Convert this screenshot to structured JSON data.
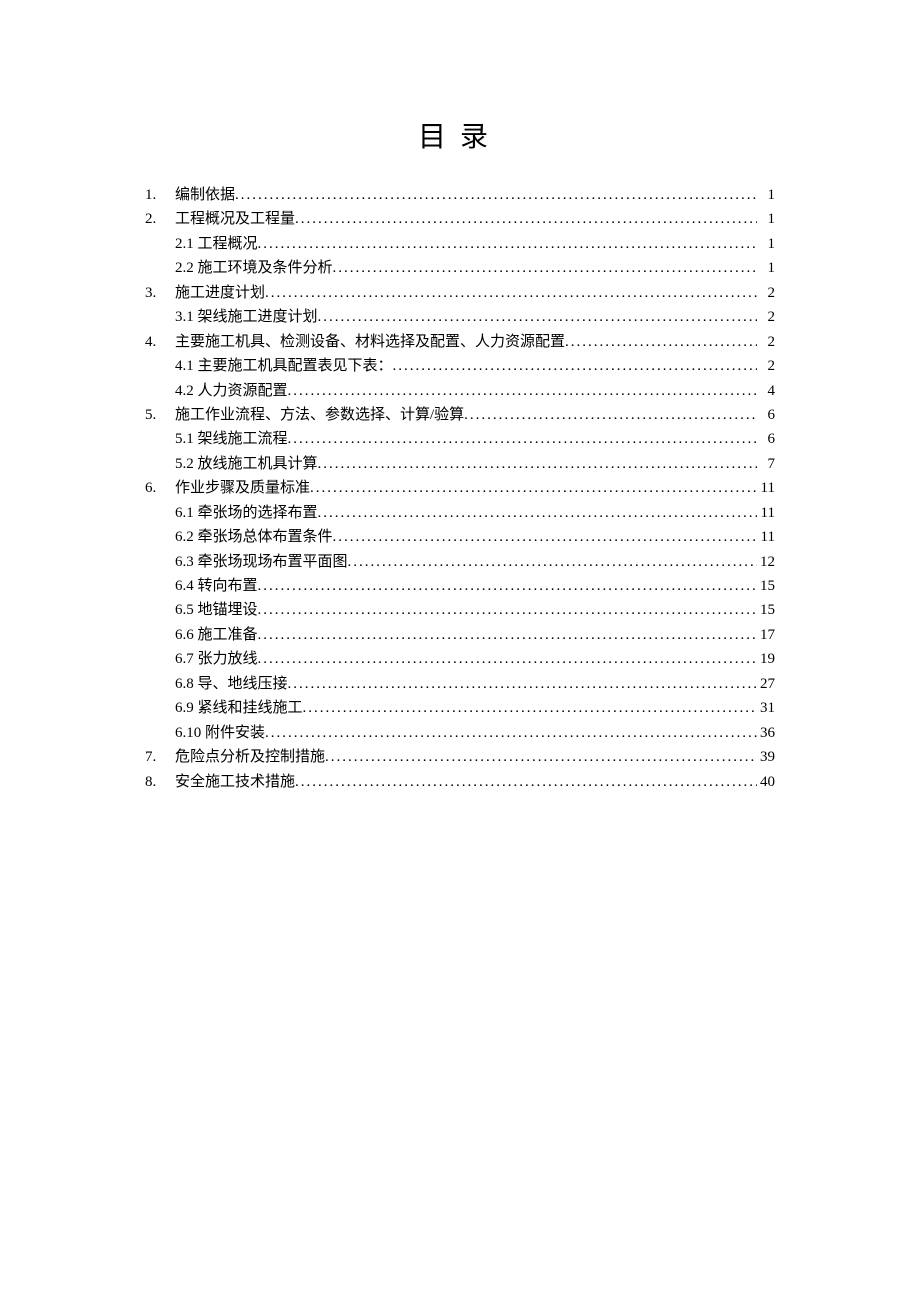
{
  "title": "目录",
  "toc": [
    {
      "num": "1.",
      "label": "  编制依据",
      "page": "1",
      "sub": false
    },
    {
      "num": "2.",
      "label": "工程概况及工程量",
      "page": "1",
      "sub": false
    },
    {
      "num": "",
      "label": "2.1 工程概况",
      "page": "1",
      "sub": true
    },
    {
      "num": "",
      "label": "2.2 施工环境及条件分析",
      "page": "1",
      "sub": true
    },
    {
      "num": "3.",
      "label": "施工进度计划",
      "page": "2",
      "sub": false
    },
    {
      "num": "",
      "label": "3.1 架线施工进度计划",
      "page": "2",
      "sub": true
    },
    {
      "num": "4.",
      "label": "主要施工机具、检测设备、材料选择及配置、人力资源配置",
      "page": "2",
      "sub": false
    },
    {
      "num": "",
      "label": "4.1 主要施工机具配置表见下表：",
      "page": "2",
      "sub": true
    },
    {
      "num": "",
      "label": "4.2 人力资源配置",
      "page": "4",
      "sub": true
    },
    {
      "num": "5.",
      "label": "施工作业流程、方法、参数选择、计算/验算",
      "page": "6",
      "sub": false
    },
    {
      "num": "",
      "label": "5.1 架线施工流程",
      "page": "6",
      "sub": true
    },
    {
      "num": "",
      "label": "5.2 放线施工机具计算",
      "page": "7",
      "sub": true
    },
    {
      "num": "6.",
      "label": "作业步骤及质量标准",
      "page": "11",
      "sub": false
    },
    {
      "num": "",
      "label": "6.1 牵张场的选择布置",
      "page": "11",
      "sub": true
    },
    {
      "num": "",
      "label": "6.2 牵张场总体布置条件",
      "page": "11",
      "sub": true
    },
    {
      "num": "",
      "label": "6.3 牵张场现场布置平面图",
      "page": "12",
      "sub": true
    },
    {
      "num": "",
      "label": "6.4 转向布置",
      "page": "15",
      "sub": true
    },
    {
      "num": "",
      "label": "6.5 地锚埋设",
      "page": "15",
      "sub": true
    },
    {
      "num": "",
      "label": "6.6 施工准备",
      "page": "17",
      "sub": true
    },
    {
      "num": "",
      "label": "6.7 张力放线",
      "page": "19",
      "sub": true
    },
    {
      "num": "",
      "label": "6.8 导、地线压接",
      "page": "27",
      "sub": true
    },
    {
      "num": "",
      "label": "6.9 紧线和挂线施工",
      "page": "31",
      "sub": true
    },
    {
      "num": "",
      "label": "6.10 附件安装",
      "page": "36",
      "sub": true
    },
    {
      "num": "7.",
      "label": "危险点分析及控制措施",
      "page": "39",
      "sub": false
    },
    {
      "num": "8.",
      "label": "安全施工技术措施",
      "page": "40",
      "sub": false
    }
  ]
}
